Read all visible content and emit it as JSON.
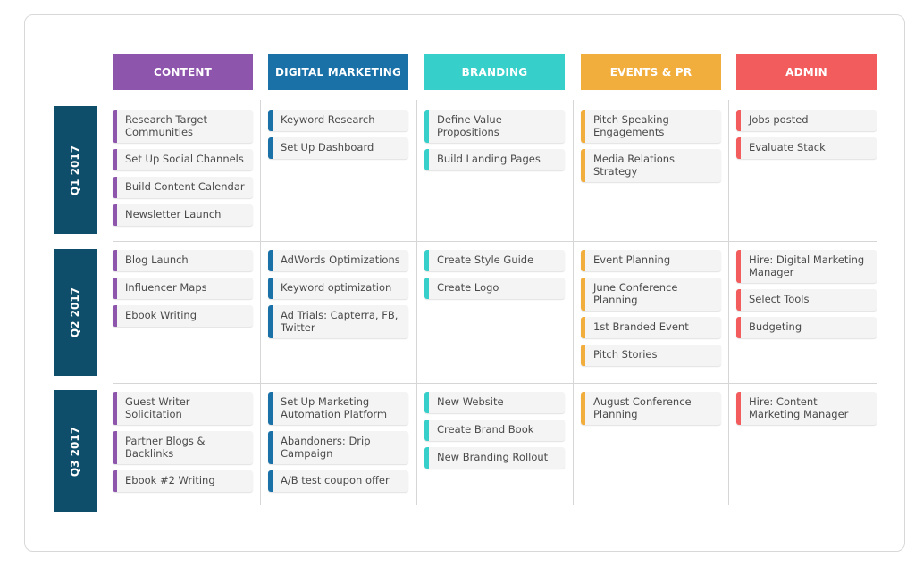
{
  "columns": [
    {
      "label": "CONTENT",
      "color": "#8e55ad"
    },
    {
      "label": "DIGITAL MARKETING",
      "color": "#1a71a8"
    },
    {
      "label": "BRANDING",
      "color": "#36cfc9"
    },
    {
      "label": "EVENTS & PR",
      "color": "#f2ae3d"
    },
    {
      "label": "ADMIN",
      "color": "#f25c5c"
    }
  ],
  "rows": [
    {
      "label": "Q1 2017",
      "cells": [
        [
          "Research Target Communities",
          "Set Up Social Channels",
          "Build Content Calendar",
          "Newsletter Launch"
        ],
        [
          "Keyword Research",
          "Set Up Dashboard"
        ],
        [
          "Define Value Propositions",
          "Build Landing Pages"
        ],
        [
          "Pitch Speaking Engagements",
          "Media Relations Strategy"
        ],
        [
          "Jobs posted",
          "Evaluate Stack"
        ]
      ]
    },
    {
      "label": "Q2 2017",
      "cells": [
        [
          "Blog Launch",
          "Influencer Maps",
          "Ebook Writing"
        ],
        [
          "AdWords Optimizations",
          "Keyword optimization",
          "Ad Trials: Capterra, FB, Twitter"
        ],
        [
          "Create Style Guide",
          "Create Logo"
        ],
        [
          "Event Planning",
          "June Conference Planning",
          "1st Branded Event",
          "Pitch Stories"
        ],
        [
          "Hire: Digital Marketing Manager",
          "Select Tools",
          "Budgeting"
        ]
      ]
    },
    {
      "label": "Q3 2017",
      "cells": [
        [
          "Guest Writer Solicitation",
          "Partner Blogs & Backlinks",
          "Ebook #2 Writing"
        ],
        [
          "Set Up Marketing Automation Platform",
          "Abandoners: Drip Campaign",
          "A/B test coupon offer"
        ],
        [
          "New Website",
          "Create Brand Book",
          "New Branding Rollout"
        ],
        [
          "August Conference Planning"
        ],
        [
          "Hire: Content Marketing Manager"
        ]
      ]
    }
  ]
}
